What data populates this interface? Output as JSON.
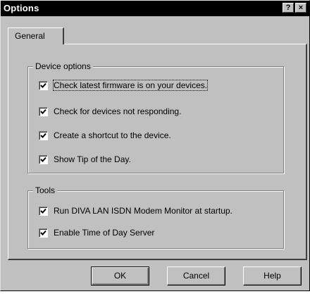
{
  "window": {
    "title": "Options",
    "help_button": "?",
    "close_button": "×"
  },
  "tabs": [
    {
      "label": "General",
      "selected": true
    }
  ],
  "device_options": {
    "title": "Device options",
    "items": [
      {
        "label": "Check latest firmware is on your devices.",
        "checked": true
      },
      {
        "label": "Check for devices not responding.",
        "checked": true
      },
      {
        "label": "Create a shortcut to the device.",
        "checked": true
      },
      {
        "label": "Show Tip of the Day.",
        "checked": true
      }
    ]
  },
  "tools": {
    "title": "Tools",
    "items": [
      {
        "label": "Run DIVA LAN ISDN Modem Monitor at startup.",
        "checked": true
      },
      {
        "label": "Enable Time of Day Server",
        "checked": true
      }
    ]
  },
  "buttons": {
    "ok": "OK",
    "cancel": "Cancel",
    "help": "Help"
  }
}
